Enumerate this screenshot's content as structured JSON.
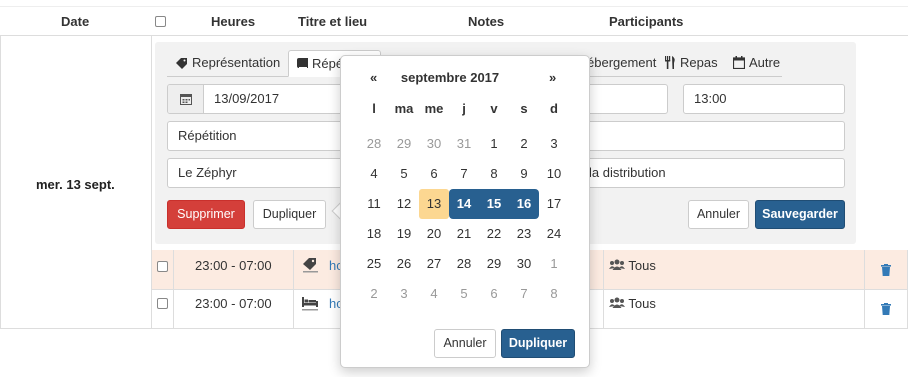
{
  "table": {
    "headers": {
      "date": "Date",
      "heures": "Heures",
      "titre": "Titre et lieu",
      "notes": "Notes",
      "participants": "Participants"
    },
    "group_date": "mer. 13 sept."
  },
  "editor": {
    "tabs": [
      {
        "label": "Représentation",
        "icon": "ticket-icon"
      },
      {
        "label": "Répé",
        "icon": "book-icon"
      },
      {
        "label": "ébergement",
        "icon": "bed-icon"
      },
      {
        "label": "Repas",
        "icon": "cutlery-icon"
      },
      {
        "label": "Autre",
        "icon": "calendar-icon"
      }
    ],
    "date_value": "13/09/2017",
    "time_value": "13:00",
    "title_value": "Répétition",
    "location_value": "Le Zéphyr",
    "participants_value": "la distribution",
    "delete_label": "Supprimer",
    "duplicate_label": "Dupliquer",
    "cancel_label": "Annuler",
    "save_label": "Sauvegarder"
  },
  "rows": [
    {
      "time": "23:00 - 07:00",
      "title": "hc",
      "icon": "ticket-icon",
      "participants": "Tous"
    },
    {
      "time": "23:00 - 07:00",
      "title": "hc",
      "icon": "bed-icon",
      "participants": "Tous"
    }
  ],
  "calendar": {
    "prev": "«",
    "next": "»",
    "month_label": "septembre 2017",
    "weekdays": [
      "l",
      "ma",
      "me",
      "j",
      "v",
      "s",
      "d"
    ],
    "weeks": [
      [
        "28",
        "29",
        "30",
        "31",
        "1",
        "2",
        "3"
      ],
      [
        "4",
        "5",
        "6",
        "7",
        "8",
        "9",
        "10"
      ],
      [
        "11",
        "12",
        "13",
        "14",
        "15",
        "16",
        "17"
      ],
      [
        "18",
        "19",
        "20",
        "21",
        "22",
        "23",
        "24"
      ],
      [
        "25",
        "26",
        "27",
        "28",
        "29",
        "30",
        "1"
      ],
      [
        "2",
        "3",
        "4",
        "5",
        "6",
        "7",
        "8"
      ]
    ],
    "today": "13",
    "selected": [
      "14",
      "15",
      "16"
    ],
    "cancel_label": "Annuler",
    "confirm_label": "Dupliquer"
  },
  "colors": {
    "primary": "#286090",
    "danger": "#d43f3a",
    "today": "#fcd791",
    "row_highlight": "#fcebe1",
    "link": "#337ab7"
  }
}
